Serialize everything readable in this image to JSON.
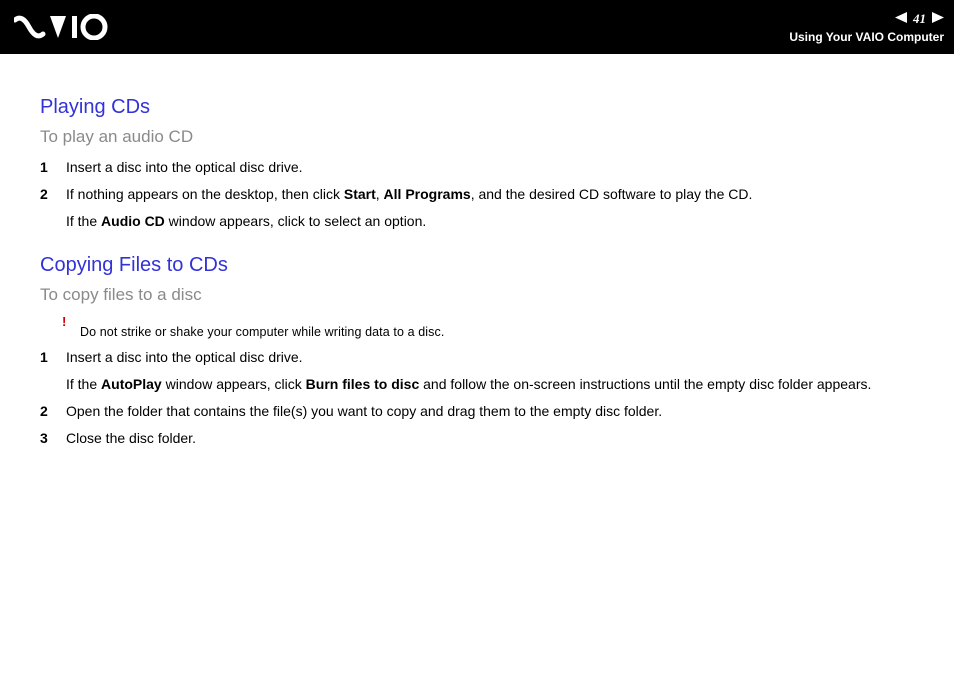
{
  "header": {
    "page_number": "41",
    "section": "Using Your VAIO Computer"
  },
  "playing": {
    "title": "Playing CDs",
    "subtitle": "To play an audio CD",
    "steps": [
      {
        "num": "1",
        "text": "Insert a disc into the optical disc drive."
      },
      {
        "num": "2",
        "text_pre": "If nothing appears on the desktop, then click ",
        "b1": "Start",
        "sep1": ", ",
        "b2": "All Programs",
        "text_post": ", and the desired CD software to play the CD.",
        "line2_pre": "If the ",
        "b3": "Audio CD",
        "line2_post": " window appears, click to select an option."
      }
    ]
  },
  "copying": {
    "title": "Copying Files to CDs",
    "subtitle": "To copy files to a disc",
    "warn_bang": "!",
    "warn_text": "Do not strike or shake your computer while writing data to a disc.",
    "steps": [
      {
        "num": "1",
        "text": "Insert a disc into the optical disc drive.",
        "line2_pre": "If the ",
        "b1": "AutoPlay",
        "line2_mid": " window appears, click ",
        "b2": "Burn files to disc",
        "line2_post": " and follow the on-screen instructions until the empty disc folder appears."
      },
      {
        "num": "2",
        "text": "Open the folder that contains the file(s) you want to copy and drag them to the empty disc folder."
      },
      {
        "num": "3",
        "text": "Close the disc folder."
      }
    ]
  }
}
